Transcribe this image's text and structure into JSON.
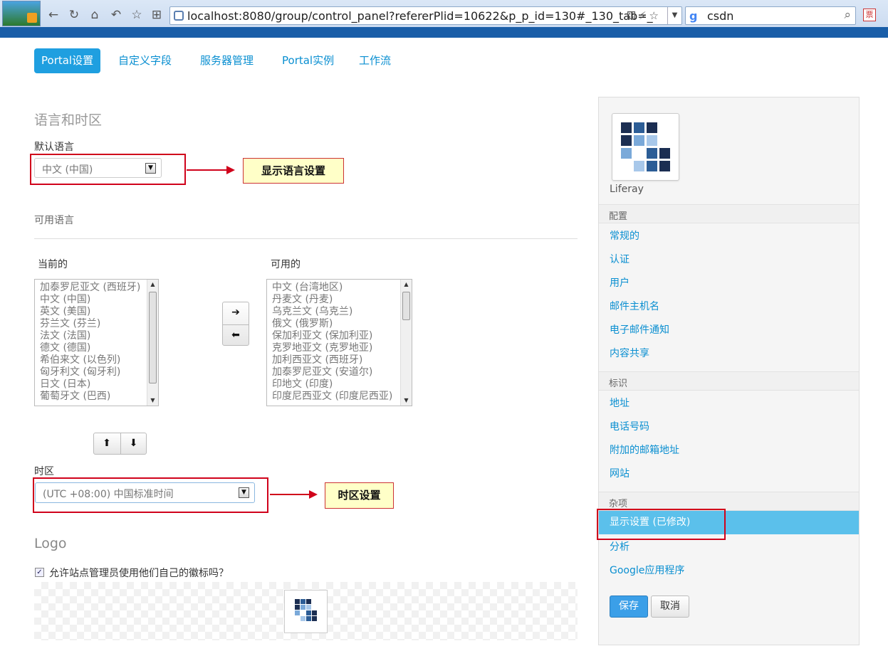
{
  "browser": {
    "url": "localhost:8080/group/control_panel?refererPlid=10622&p_p_id=130#_130_tab=_",
    "search_query": "csdn",
    "search_engine_badge": "g",
    "extension_badge": "票"
  },
  "tabs": [
    {
      "label": "Portal设置",
      "active": true
    },
    {
      "label": "自定义字段",
      "active": false
    },
    {
      "label": "服务器管理",
      "active": false
    },
    {
      "label": "Portal实例",
      "active": false
    },
    {
      "label": "工作流",
      "active": false
    }
  ],
  "language_section": {
    "title": "语言和时区",
    "default_language_label": "默认语言",
    "default_language_value": "中文 (中国)",
    "available_languages_label": "可用语言",
    "current_label": "当前的",
    "available_label": "可用的",
    "current_list": [
      "加泰罗尼亚文 (西班牙)",
      "中文 (中国)",
      "英文 (美国)",
      "芬兰文 (芬兰)",
      "法文 (法国)",
      "德文 (德国)",
      "希伯来文 (以色列)",
      "匈牙利文 (匈牙利)",
      "日文 (日本)",
      "葡萄牙文 (巴西)"
    ],
    "available_list": [
      "中文 (台湾地区)",
      "丹麦文 (丹麦)",
      "乌克兰文 (乌克兰)",
      "俄文 (俄罗斯)",
      "保加利亚文 (保加利亚)",
      "克罗地亚文 (克罗地亚)",
      "加利西亚文 (西班牙)",
      "加泰罗尼亚文 (安道尔)",
      "印地文 (印度)",
      "印度尼西亚文 (印度尼西亚)"
    ],
    "timezone_label": "时区",
    "timezone_value": "(UTC +08:00) 中国标准时间"
  },
  "annotations": {
    "language_callout": "显示语言设置",
    "timezone_callout": "时区设置"
  },
  "logo_section": {
    "title": "Logo",
    "allow_site_logo_label": "允许站点管理员使用他们自己的徽标吗？",
    "allow_site_logo_checked": true
  },
  "sidebar": {
    "site_name": "Liferay",
    "sections": [
      {
        "title": "配置",
        "items": [
          "常规的",
          "认证",
          "用户",
          "邮件主机名",
          "电子邮件通知",
          "内容共享"
        ]
      },
      {
        "title": "标识",
        "items": [
          "地址",
          "电话号码",
          "附加的邮箱地址",
          "网站"
        ]
      },
      {
        "title": "杂项",
        "items": [
          "显示设置 (已修改)",
          "分析",
          "Google应用程序"
        ]
      }
    ],
    "selected_item": "显示设置 (已修改)",
    "save_label": "保存",
    "cancel_label": "取消"
  },
  "colors": {
    "accent": "#1f9fe0",
    "link": "#0a8fd1",
    "highlight": "#5bc0eb",
    "annotation_red": "#d0021b",
    "callout_bg": "#ffffc8"
  }
}
